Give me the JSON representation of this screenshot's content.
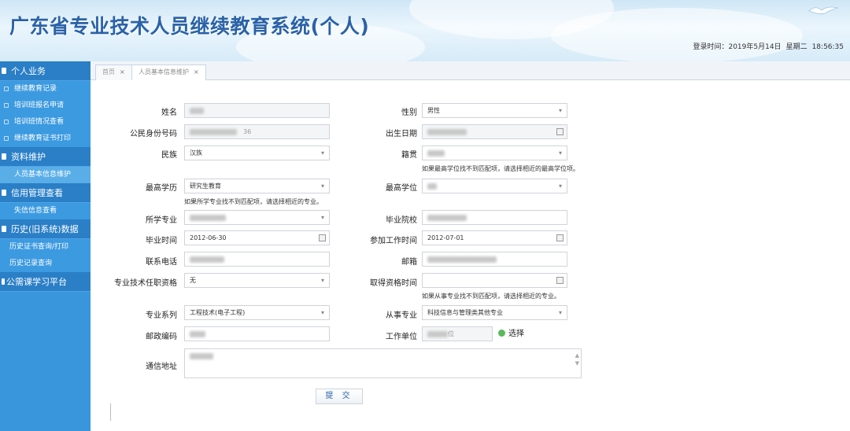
{
  "header": {
    "title": "广东省专业技术人员继续教育系统(个人)",
    "login_label": "登录时间：2019年5月14日",
    "weekday": "星期二",
    "time": "18:56:35"
  },
  "sidebar": {
    "groups": [
      {
        "label": "个人业务",
        "items": [
          "继续教育记录",
          "培训班报名申请",
          "培训班情况查看",
          "继续教育证书打印"
        ]
      },
      {
        "label": "资料维护",
        "items": [
          "人员基本信息维护"
        ]
      },
      {
        "label": "信用管理查看",
        "items": [
          "失信信息查看"
        ]
      },
      {
        "label": "历史(旧系统)数据",
        "items": [
          "历史证书查询/打印",
          "历史记录查询"
        ]
      },
      {
        "label": "公需课学习平台",
        "items": []
      }
    ]
  },
  "tabs": [
    {
      "label": "首页",
      "close": "×"
    },
    {
      "label": "人员基本信息维护",
      "close": "×"
    }
  ],
  "form": {
    "name_label": "姓名",
    "gender_label": "性别",
    "gender_value": "男性",
    "id_label": "公民身份号码",
    "id_value_tail": "36",
    "birth_label": "出生日期",
    "ethnicity_label": "民族",
    "ethnicity_value": "汉族",
    "native_label": "籍贯",
    "degree_hint": "如果最高学位找不到匹配项，请选择相近的最高学位项。",
    "edu_label": "最高学历",
    "edu_value": "研究生教育",
    "degree_label": "最高学位",
    "major_hint": "如果所学专业找不到匹配项，请选择相近的专业。",
    "major_label": "所学专业",
    "school_label": "毕业院校",
    "grad_time_label": "毕业时间",
    "grad_time_value": "2012-06-30",
    "work_time_label": "参加工作时间",
    "work_time_value": "2012-07-01",
    "phone_label": "联系电话",
    "email_label": "邮箱",
    "title_label": "专业技术任职资格",
    "title_value": "无",
    "qual_time_label": "取得资格时间",
    "field_hint": "如果从事专业找不到匹配项，请选择相近的专业。",
    "series_label": "专业系列",
    "series_value": "工程技术(电子工程)",
    "field_label": "从事专业",
    "field_value": "科技信息与管理类其他专业",
    "postcode_label": "邮政编码",
    "employer_label": "工作单位",
    "employer_tail": "位",
    "select_label": "选择",
    "address_label": "通信地址",
    "submit_label": "提 交"
  }
}
